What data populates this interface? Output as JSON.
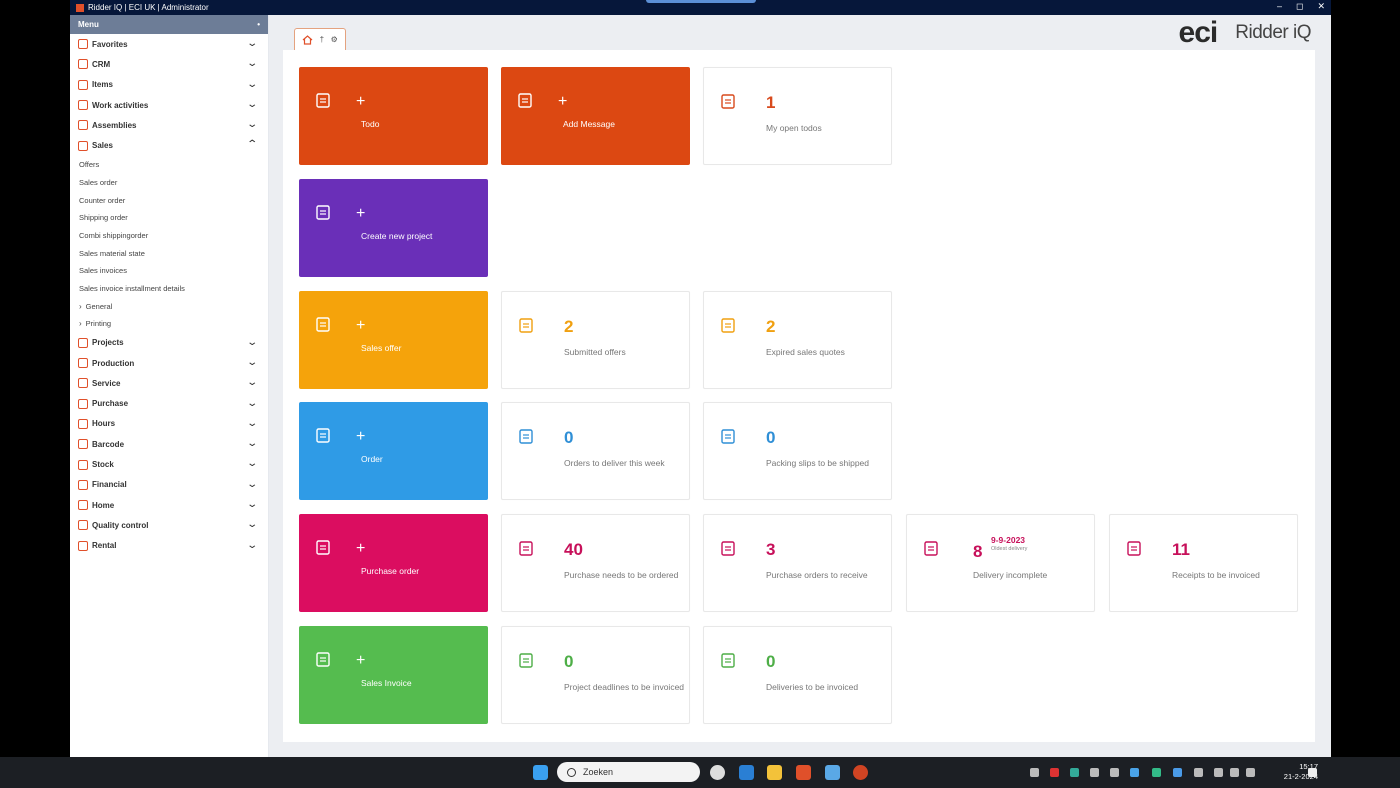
{
  "window": {
    "title": "Ridder IQ | ECI UK | Administrator",
    "controls": [
      "–",
      "◻",
      "✕"
    ]
  },
  "sidebar": {
    "header": "Menu",
    "pin": "’",
    "items_before": [
      {
        "label": "Favorites"
      },
      {
        "label": "CRM"
      },
      {
        "label": "Items"
      },
      {
        "label": "Work activities"
      },
      {
        "label": "Assemblies"
      }
    ],
    "sales": {
      "label": "Sales",
      "subitems": [
        "Offers",
        "Sales order",
        "Counter order",
        "Shipping order",
        "Combi shippingorder",
        "Sales material state",
        "Sales invoices",
        "Sales invoice installment details"
      ],
      "subgroups": [
        "General",
        "Printing"
      ]
    },
    "items_after": [
      {
        "label": "Projects"
      },
      {
        "label": "Production"
      },
      {
        "label": "Service"
      },
      {
        "label": "Purchase"
      },
      {
        "label": "Hours"
      },
      {
        "label": "Barcode"
      },
      {
        "label": "Stock"
      },
      {
        "label": "Financial"
      },
      {
        "label": "Home"
      },
      {
        "label": "Quality control"
      },
      {
        "label": "Rental"
      }
    ]
  },
  "brand": {
    "logo": "eci",
    "product": "Ridder iQ"
  },
  "tiles": {
    "todo": {
      "plus": "+",
      "label": "Todo"
    },
    "add_message": {
      "plus": "+",
      "label": "Add Message"
    },
    "my_open_todos": {
      "value": "1",
      "label": "My open todos"
    },
    "create_project": {
      "plus": "+",
      "label": "Create new project"
    },
    "sales_offer": {
      "plus": "+",
      "label": "Sales offer"
    },
    "submitted_offers": {
      "value": "2",
      "label": "Submitted offers"
    },
    "expired_quotes": {
      "value": "2",
      "label": "Expired sales quotes"
    },
    "order": {
      "plus": "+",
      "label": "Order"
    },
    "orders_deliver": {
      "value": "0",
      "label": "Orders to deliver this week"
    },
    "packing_slips": {
      "value": "0",
      "label": "Packing slips to be shipped"
    },
    "purchase_order": {
      "plus": "+",
      "label": "Purchase order"
    },
    "purchase_needs": {
      "value": "40",
      "label": "Purchase needs to be ordered"
    },
    "po_receive": {
      "value": "3",
      "label": "Purchase orders to receive"
    },
    "delivery_incomplete": {
      "value": "8",
      "date": "9-9-2023",
      "note": "Oldest delivery",
      "label": "Delivery incomplete"
    },
    "receipts_invoiced": {
      "value": "11",
      "label": "Receipts to be invoiced"
    },
    "sales_invoice": {
      "plus": "+",
      "label": "Sales Invoice"
    },
    "project_deadlines": {
      "value": "0",
      "label": "Project deadlines to be invoiced"
    },
    "deliveries_invoiced": {
      "value": "0",
      "label": "Deliveries to be invoiced"
    }
  },
  "colors": {
    "orange": "#dc4812",
    "purple": "#6a2fb8",
    "amber": "#f5a30b",
    "blue": "#2f9be6",
    "magenta": "#db0d60",
    "green": "#55bc4f",
    "orange_text": "#d84a1d",
    "amber_text": "#f0a010",
    "blue_text": "#2f8fd6",
    "magenta_text": "#c7105a",
    "green_text": "#4eae47"
  },
  "taskbar": {
    "search_placeholder": "Zoeken",
    "time": "15:17",
    "date": "21-2-2024"
  }
}
